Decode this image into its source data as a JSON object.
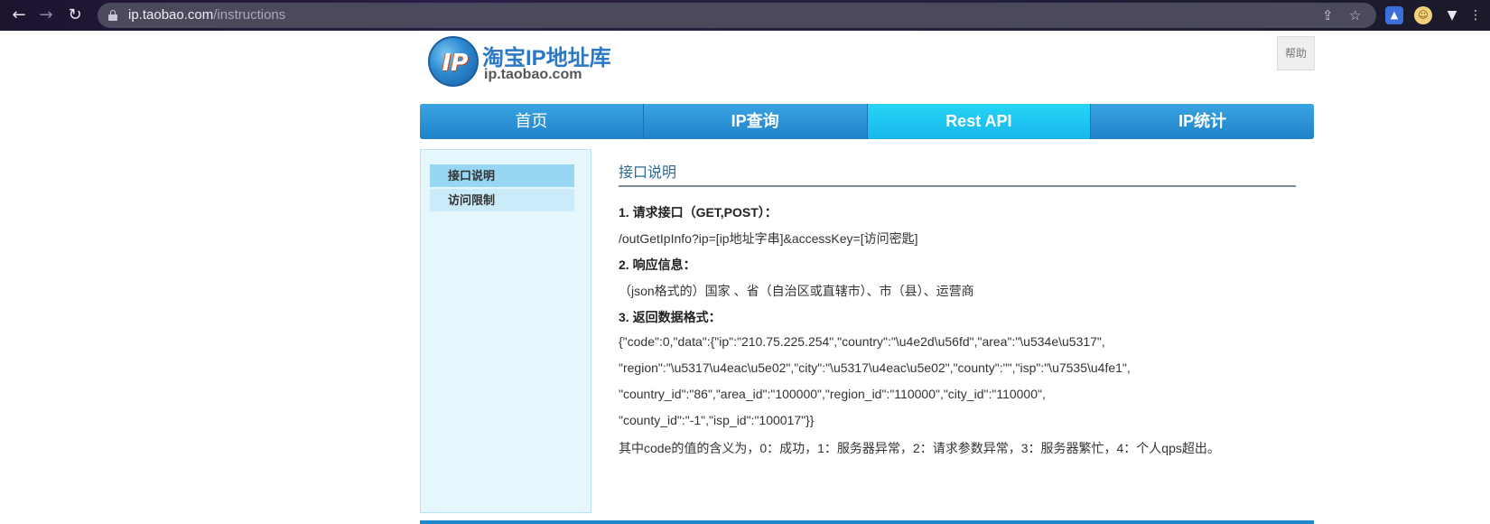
{
  "browser": {
    "url_host": "ip.taobao.com",
    "url_path": "/instructions",
    "icons": [
      "back-arrow-icon",
      "forward-arrow-icon",
      "reload-icon",
      "lock-icon",
      "share-icon",
      "bookmark-star-icon",
      "extension-cap-icon",
      "extension-face-icon",
      "extension-v-icon",
      "menu-icon"
    ]
  },
  "logo": {
    "title": "淘宝IP地址库",
    "domain": "ip.taobao.com",
    "badge": "IP"
  },
  "help_label": "帮助",
  "nav": {
    "tabs": [
      {
        "label": "首页"
      },
      {
        "label": "IP查询"
      },
      {
        "label": "Rest API"
      },
      {
        "label": "IP统计"
      }
    ],
    "active": "Rest API"
  },
  "sidebar": {
    "items": [
      {
        "label": "接口说明"
      },
      {
        "label": "访问限制"
      }
    ],
    "active": "接口说明"
  },
  "content": {
    "title": "接口说明",
    "h1": "1. 请求接口（GET,POST）：",
    "request_url": "/outGetIpInfo?ip=[ip地址字串]&accessKey=[访问密匙]",
    "h2": "2. 响应信息：",
    "response_info": "（json格式的）国家 、省（自治区或直辖市）、市（县）、运营商",
    "h3": "3. 返回数据格式：",
    "json_lines": [
      "{\"code\":0,\"data\":{\"ip\":\"210.75.225.254\",\"country\":\"\\u4e2d\\u56fd\",\"area\":\"\\u534e\\u5317\",",
      "\"region\":\"\\u5317\\u4eac\\u5e02\",\"city\":\"\\u5317\\u4eac\\u5e02\",\"county\":\"\",\"isp\":\"\\u7535\\u4fe1\",",
      "\"country_id\":\"86\",\"area_id\":\"100000\",\"region_id\":\"110000\",\"city_id\":\"110000\",",
      "\"county_id\":\"-1\",\"isp_id\":\"100017\"}}"
    ],
    "code_note": "其中code的值的含义为，0：成功，1：服务器异常，2：请求参数异常，3：服务器繁忙，4：个人qps超出。"
  },
  "colors": {
    "nav_blue": "#1f82c9",
    "nav_active": "#17b7ec",
    "sidebar_bg": "#e6f6fd",
    "logo_blue": "#2b78c5"
  }
}
